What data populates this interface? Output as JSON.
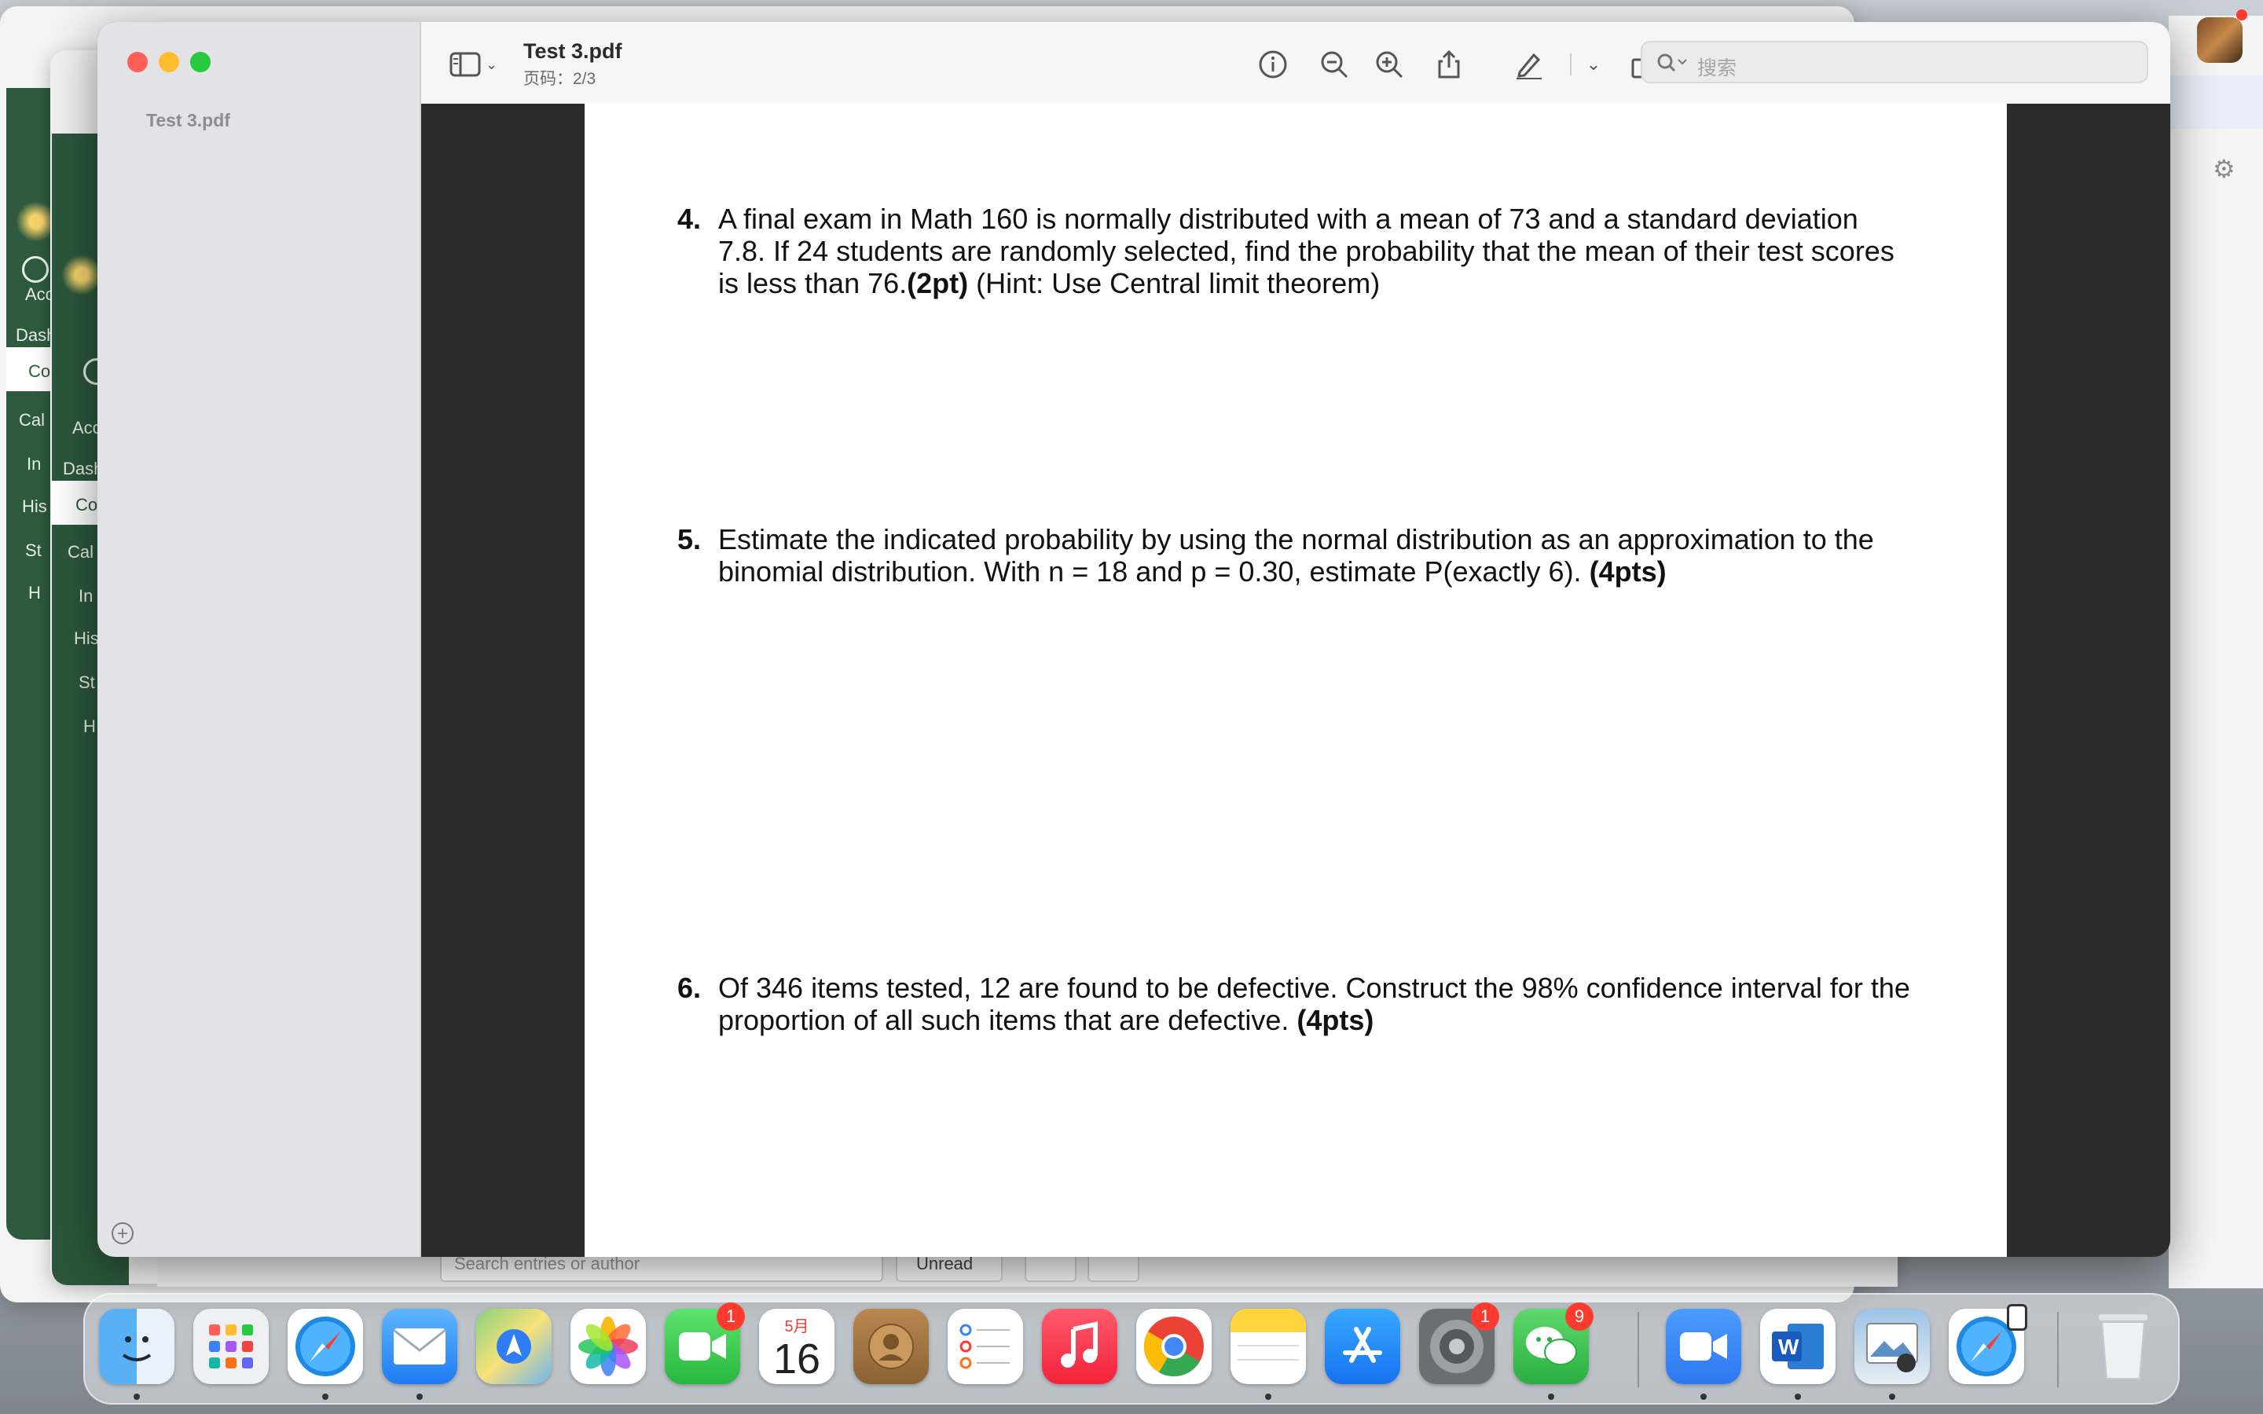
{
  "preview": {
    "sidebar_file": "Test 3.pdf",
    "title": "Test 3.pdf",
    "page_indicator": "页码：2/3",
    "search_placeholder": "搜索"
  },
  "background_app": {
    "nav_labels": [
      "Acc",
      "Dash",
      "Co",
      "Cal",
      "In",
      "His",
      "St",
      "H"
    ],
    "search_hint": "Search entries or author",
    "filter_button": "Unread"
  },
  "questions": [
    {
      "number": "4.",
      "text": "A final exam in Math 160 is normally distributed with a mean of 73 and a standard deviation 7.8. If 24 students are randomly selected, find the probability that the mean of their test scores is less than 76.",
      "points": "(2pt)",
      "tail": " (Hint: Use Central limit theorem)"
    },
    {
      "number": "5.",
      "text": "Estimate the indicated probability by using the normal distribution as an approximation to the binomial distribution. With n = 18 and p = 0.30, estimate P(exactly 6). ",
      "points": "(4pts)",
      "tail": ""
    },
    {
      "number": "6.",
      "text": "Of 346 items tested, 12 are found to be defective. Construct the 98% confidence interval for the proportion of all such items that are defective. ",
      "points": "(4pts)",
      "tail": ""
    }
  ],
  "dock": {
    "facetime_badge": "1",
    "calendar_month": "5月",
    "calendar_day": "16",
    "settings_badge": "1",
    "wechat_badge": "9"
  },
  "colors": {
    "canvas_green": "#2e5a3e",
    "close": "#ff5f57",
    "minimize": "#febc2e",
    "zoom": "#28c840",
    "badge": "#ff3b30"
  }
}
